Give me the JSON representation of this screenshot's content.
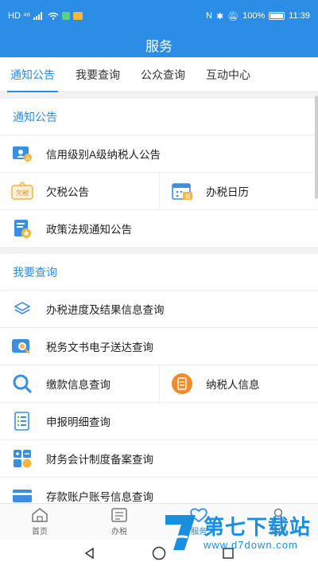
{
  "status_bar": {
    "left": "HD ⁴⁶",
    "battery": "100%",
    "time": "11:39"
  },
  "header": {
    "title": "服务"
  },
  "tabs": [
    {
      "label": "通知公告",
      "active": true
    },
    {
      "label": "我要查询",
      "active": false
    },
    {
      "label": "公众查询",
      "active": false
    },
    {
      "label": "互动中心",
      "active": false
    }
  ],
  "sections": {
    "notice": {
      "title": "通知公告",
      "items": {
        "credit_a": "信用级别A级纳税人公告",
        "tax_arrears": "欠税公告",
        "tax_calendar": "办税日历",
        "policy": "政策法规通知公告"
      }
    },
    "query": {
      "title": "我要查询",
      "items": {
        "progress": "办税进度及结果信息查询",
        "documents": "税务文书电子送达查询",
        "payment": "缴款信息查询",
        "taxpayer_info": "纳税人信息",
        "declaration": "申报明细查询",
        "accounting": "财务会计制度备案查询",
        "bank_account": "存款账户账号信息查询"
      }
    }
  },
  "icon_labels": {
    "arrears": "欠税",
    "calendar": "税"
  },
  "bottom_nav": [
    {
      "label": "首页",
      "icon": "home-icon",
      "active": false
    },
    {
      "label": "办税",
      "icon": "tax-icon",
      "active": false
    },
    {
      "label": "服务",
      "icon": "heart-icon",
      "active": true
    },
    {
      "label": "我的",
      "icon": "user-icon",
      "active": false
    }
  ],
  "watermark": {
    "title": "第七下载站",
    "url": "www.d7down.com"
  },
  "colors": {
    "primary": "#2b8de6",
    "orange": "#f08a2a",
    "green": "#3cc07a"
  }
}
